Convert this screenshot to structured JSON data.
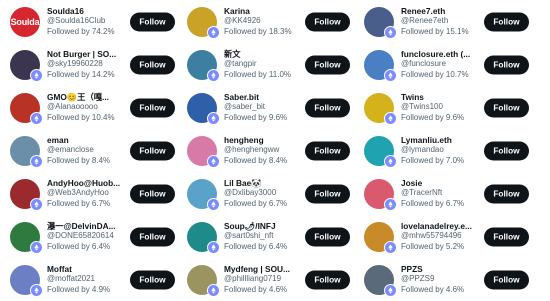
{
  "follow_label": "Follow",
  "accounts": [
    {
      "name": "Soulda16",
      "handle": "@Soulda16Club",
      "followed": "Followed by 74.2%",
      "avatar_text": "Soulda",
      "avatar_color": "#d6262e",
      "verified": false
    },
    {
      "name": "Not Burger | SO...",
      "handle": "@sky19960228",
      "followed": "Followed by 14.2%",
      "avatar_text": "",
      "avatar_color": "#3b3550",
      "verified": true
    },
    {
      "name": "GMO😊王（嘎...",
      "handle": "@Alanaooooo",
      "followed": "Followed by 10.4%",
      "avatar_text": "",
      "avatar_color": "#b83326",
      "verified": true
    },
    {
      "name": "eman",
      "handle": "@emanclose",
      "followed": "Followed by 8.4%",
      "avatar_text": "",
      "avatar_color": "#6b8fa8",
      "verified": true
    },
    {
      "name": "AndyHoo@Huob...",
      "handle": "@Web3AndyHoo",
      "followed": "Followed by 6.7%",
      "avatar_text": "",
      "avatar_color": "#9b2a2e",
      "verified": true
    },
    {
      "name": "瀑一@DelvinDA...",
      "handle": "@DONE65820614",
      "followed": "Followed by 6.4%",
      "avatar_text": "",
      "avatar_color": "#2f7a3f",
      "verified": true
    },
    {
      "name": "Moffat",
      "handle": "@moffat2021",
      "followed": "Followed by 4.9%",
      "avatar_text": "",
      "avatar_color": "#6c7fc4",
      "verified": true
    },
    {
      "name": "Karina",
      "handle": "@KK4926",
      "followed": "Followed by 18.3%",
      "avatar_text": "",
      "avatar_color": "#c9a227",
      "verified": true
    },
    {
      "name": "新文",
      "handle": "@tangpir",
      "followed": "Followed by 11.0%",
      "avatar_text": "",
      "avatar_color": "#3c7fa0",
      "verified": true
    },
    {
      "name": "Saber.bit",
      "handle": "@saber_bit",
      "followed": "Followed by 9.6%",
      "avatar_text": "",
      "avatar_color": "#2f5fa8",
      "verified": true
    },
    {
      "name": "hengheng",
      "handle": "@henghengww",
      "followed": "Followed by 8.4%",
      "avatar_text": "",
      "avatar_color": "#d77aa8",
      "verified": true
    },
    {
      "name": "Lil Bae🐼",
      "handle": "@Dxlibay3000",
      "followed": "Followed by 6.7%",
      "avatar_text": "",
      "avatar_color": "#5aa3c8",
      "verified": true
    },
    {
      "name": "Soup🌶/INFJ",
      "handle": "@sart0shi_nft",
      "followed": "Followed by 6.4%",
      "avatar_text": "",
      "avatar_color": "#1f8a8a",
      "verified": true
    },
    {
      "name": "Mydfeng | SOU...",
      "handle": "@phillliang0719",
      "followed": "Followed by 4.6%",
      "avatar_text": "",
      "avatar_color": "#9a9560",
      "verified": true
    },
    {
      "name": "Renee7.eth",
      "handle": "@Renee7eth",
      "followed": "Followed by 15.1%",
      "avatar_text": "",
      "avatar_color": "#4a5e8c",
      "verified": true
    },
    {
      "name": "funclosure.eth (...",
      "handle": "@funclosure",
      "followed": "Followed by 10.7%",
      "avatar_text": "",
      "avatar_color": "#4a7fc4",
      "verified": true
    },
    {
      "name": "Twins",
      "handle": "@Twins100",
      "followed": "Followed by 9.6%",
      "avatar_text": "",
      "avatar_color": "#d4b21c",
      "verified": true
    },
    {
      "name": "Lymanliu.eth",
      "handle": "@lymandao",
      "followed": "Followed by 7.0%",
      "avatar_text": "",
      "avatar_color": "#1fa3b0",
      "verified": true
    },
    {
      "name": "Josie",
      "handle": "@TracerNft",
      "followed": "Followed by 6.7%",
      "avatar_text": "",
      "avatar_color": "#d9596e",
      "verified": true
    },
    {
      "name": "lovelanadelrey.e...",
      "handle": "@mhw55794496",
      "followed": "Followed by 5.2%",
      "avatar_text": "",
      "avatar_color": "#c98a2a",
      "verified": true
    },
    {
      "name": "PPZS",
      "handle": "@PPZS9",
      "followed": "Followed by 4.6%",
      "avatar_text": "",
      "avatar_color": "#5b6a7a",
      "verified": true
    }
  ]
}
